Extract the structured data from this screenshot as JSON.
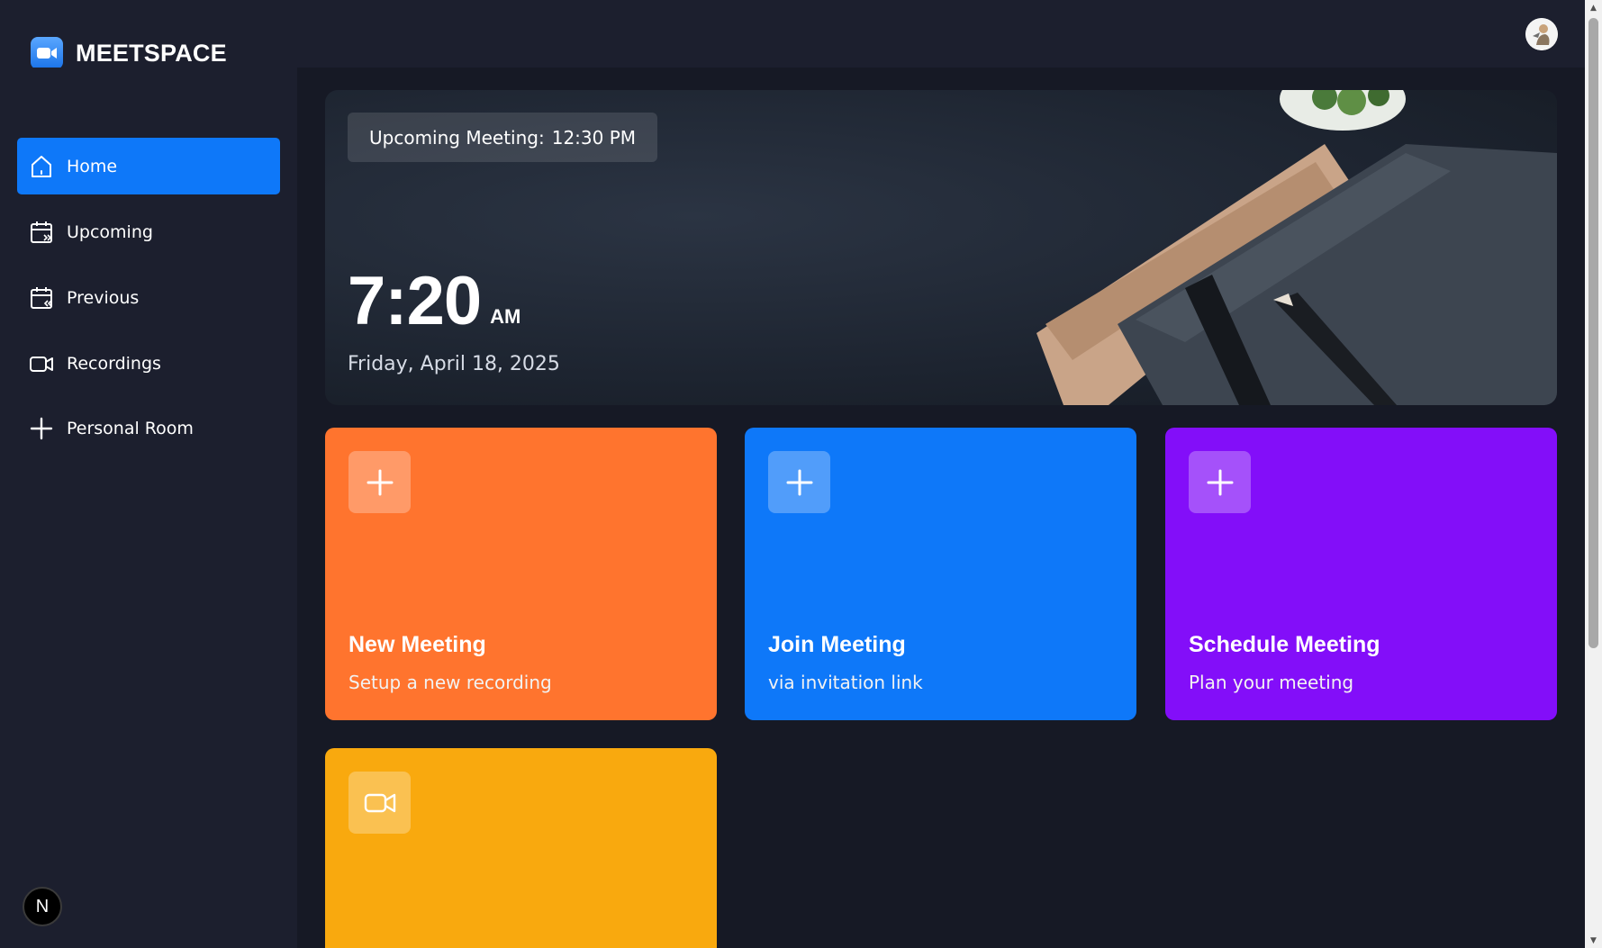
{
  "app": {
    "name": "MEETSPACE"
  },
  "sidebar": {
    "items": [
      {
        "label": "Home",
        "icon": "home-icon",
        "active": true
      },
      {
        "label": "Upcoming",
        "icon": "calendar-forward-icon",
        "active": false
      },
      {
        "label": "Previous",
        "icon": "calendar-back-icon",
        "active": false
      },
      {
        "label": "Recordings",
        "icon": "video-icon",
        "active": false
      },
      {
        "label": "Personal Room",
        "icon": "plus-icon",
        "active": false
      }
    ],
    "badge": "N"
  },
  "hero": {
    "upcoming_label": "Upcoming Meeting:",
    "upcoming_time": "12:30 PM",
    "time": "7:20",
    "ampm": "AM",
    "date": "Friday, April 18, 2025"
  },
  "cards": [
    {
      "title": "New Meeting",
      "subtitle": "Setup a new recording",
      "color": "#ff742e",
      "icon": "plus-icon"
    },
    {
      "title": "Join Meeting",
      "subtitle": "via invitation link",
      "color": "#0e78f9",
      "icon": "plus-icon"
    },
    {
      "title": "Schedule Meeting",
      "subtitle": "Plan your meeting",
      "color": "#830ef9",
      "icon": "plus-icon"
    },
    {
      "title": "",
      "subtitle": "",
      "color": "#f9a90e",
      "icon": "video-icon"
    }
  ],
  "colors": {
    "background": "#1c1f2e",
    "main_background": "#161925",
    "accent": "#0e78f9"
  }
}
